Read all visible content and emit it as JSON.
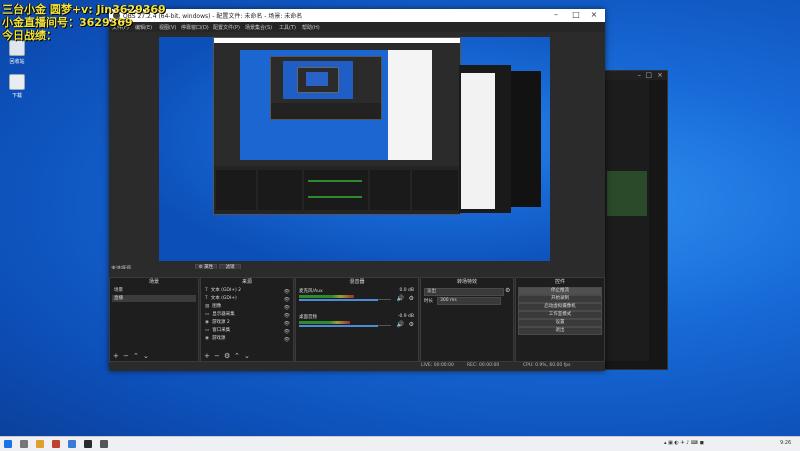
{
  "overlay": {
    "line1": "三台小金  圆梦+v: Jin3629369",
    "line2": "小金直播间号：3629369",
    "line3": "今日战绩："
  },
  "desktop_icons": [
    {
      "label": "回收站"
    },
    {
      "label": "下载"
    }
  ],
  "obs": {
    "title": "OBS 27.2.4 (64-bit, windows) - 配置文件: 未命名 - 场景: 未命名",
    "menus": [
      "文件(F)",
      "编辑(E)",
      "视图(V)",
      "停靠窗口(D)",
      "配置文件(P)",
      "场景集合(S)",
      "工具(T)",
      "帮助(H)"
    ],
    "source_label": "未选择源",
    "prop_button": "⚙ 属性",
    "filter_button": "滤镜",
    "scenes": {
      "header": "场景",
      "items": [
        {
          "label": "场景",
          "selected": false
        },
        {
          "label": "直播",
          "selected": true
        }
      ]
    },
    "sources": {
      "header": "来源",
      "items": [
        "文本 (GDI+) 2",
        "文本 (GDI+)",
        "图像",
        "显示器采集",
        "游戏源 2",
        "窗口采集",
        "游戏源"
      ]
    },
    "mixer": {
      "header": "混音器",
      "channels": [
        {
          "name": "麦克风/Aux",
          "db": "0.0 dB",
          "level": 0.6,
          "fader": 0.86
        },
        {
          "name": "桌面音频",
          "db": "-0.9 dB",
          "level": 0.55,
          "fader": 0.86
        }
      ]
    },
    "transitions": {
      "header": "转场特效",
      "selected": "淡出",
      "duration_label": "时长",
      "duration_value": "300 ms"
    },
    "controls": {
      "header": "控件",
      "buttons": [
        "停止推流",
        "开始录制",
        "启动虚拟摄像机",
        "工作室模式",
        "设置",
        "退出"
      ]
    },
    "status": {
      "live": "LIVE: 00:00:00",
      "rec": "REC: 00:00:00",
      "cpu": "CPU: 0.9%, 60.00 fps"
    }
  },
  "taskbar": {
    "time": "9:26"
  },
  "colors": {
    "overlay_text": "#f5e43a",
    "obs_bg": "#2b2b2b",
    "obs_panel": "#1e1e1e",
    "desktop_blue": "#1769d6",
    "stop_button": "#3a3a3a"
  }
}
